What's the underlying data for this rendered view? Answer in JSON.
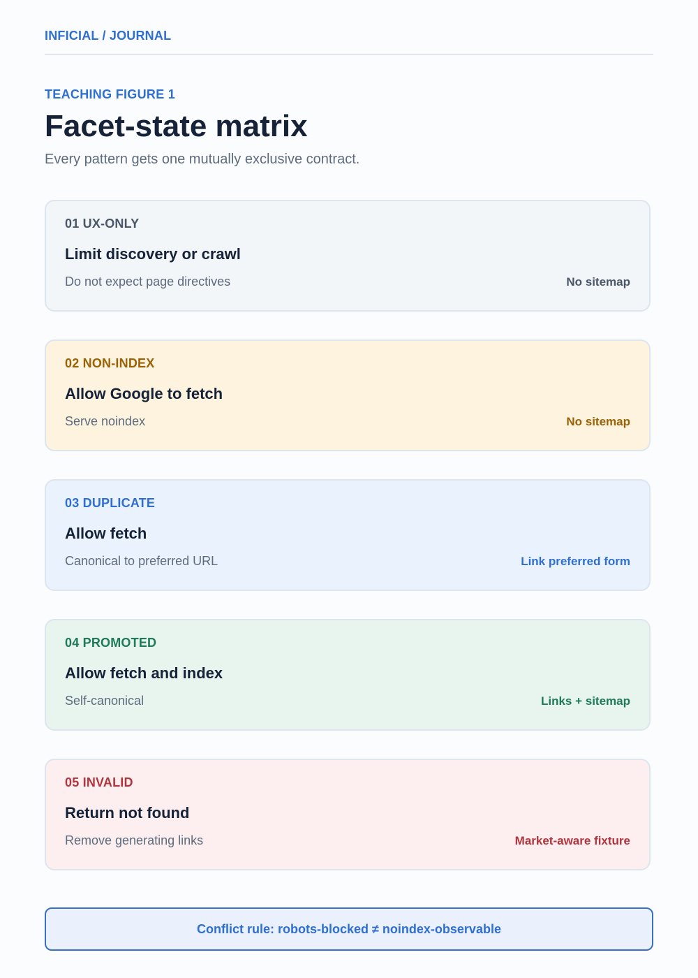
{
  "header": {
    "brand": "INFICIAL / JOURNAL"
  },
  "figure": {
    "eyebrow": "TEACHING FIGURE 1",
    "title": "Facet-state matrix",
    "subtitle": "Every pattern gets one mutually exclusive contract."
  },
  "states": [
    {
      "code": "01 UX-ONLY",
      "action": "Limit discovery or crawl",
      "detail": "Do not expect page directives",
      "tag": "No sitemap",
      "accent": "#4b5769",
      "background": "#f3f6f9"
    },
    {
      "code": "02 NON-INDEX",
      "action": "Allow Google to fetch",
      "detail": "Serve noindex",
      "tag": "No sitemap",
      "accent": "#9a6206",
      "background": "#fdf3df"
    },
    {
      "code": "03 DUPLICATE",
      "action": "Allow fetch",
      "detail": "Canonical to preferred URL",
      "tag": "Link preferred form",
      "accent": "#2f6fd1",
      "background": "#eaf2fe"
    },
    {
      "code": "04 PROMOTED",
      "action": "Allow fetch and index",
      "detail": "Self-canonical",
      "tag": "Links + sitemap",
      "accent": "#1e7a57",
      "background": "#e8f5ef"
    },
    {
      "code": "05 INVALID",
      "action": "Return not found",
      "detail": "Remove generating links",
      "tag": "Market-aware fixture",
      "accent": "#b0353c",
      "background": "#fdeff0"
    }
  ],
  "conflict_rule": "Conflict rule: robots-blocked ≠ noindex-observable"
}
